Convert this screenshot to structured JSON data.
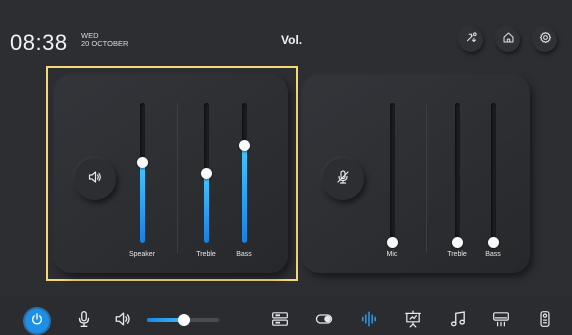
{
  "header": {
    "time": "08:38",
    "weekday": "WED",
    "date": "20 OCTOBER",
    "title": "Vol.",
    "buttons": [
      {
        "icon": "swap-edit-icon"
      },
      {
        "icon": "home-icon"
      },
      {
        "icon": "settings-icon"
      }
    ]
  },
  "speaker_panel": {
    "button_icon": "speaker-icon",
    "selected": true,
    "sliders": [
      {
        "label": "Speaker",
        "value": 0.57
      },
      {
        "label": "Treble",
        "value": 0.49
      },
      {
        "label": "Bass",
        "value": 0.69
      }
    ]
  },
  "mic_panel": {
    "button_icon": "mic-muted-icon",
    "selected": false,
    "sliders": [
      {
        "label": "Mic",
        "value": 0.0
      },
      {
        "label": "Treble",
        "value": 0.0
      },
      {
        "label": "Bass",
        "value": 0.0
      }
    ]
  },
  "bottom_bar": {
    "volume": 0.52,
    "items": [
      {
        "icon": "power-icon",
        "active": true
      },
      {
        "icon": "microphone-icon"
      },
      {
        "icon": "speaker-icon"
      },
      {
        "icon": "input-source-icon"
      },
      {
        "icon": "toggle-icon"
      },
      {
        "icon": "audio-wave-icon",
        "active": true
      },
      {
        "icon": "presentation-icon"
      },
      {
        "icon": "music-icon"
      },
      {
        "icon": "air-conditioner-icon"
      },
      {
        "icon": "remote-icon"
      }
    ]
  },
  "colors": {
    "background": "#2c2e32",
    "accent": "#1e8fe6",
    "selection": "#f4d879"
  }
}
